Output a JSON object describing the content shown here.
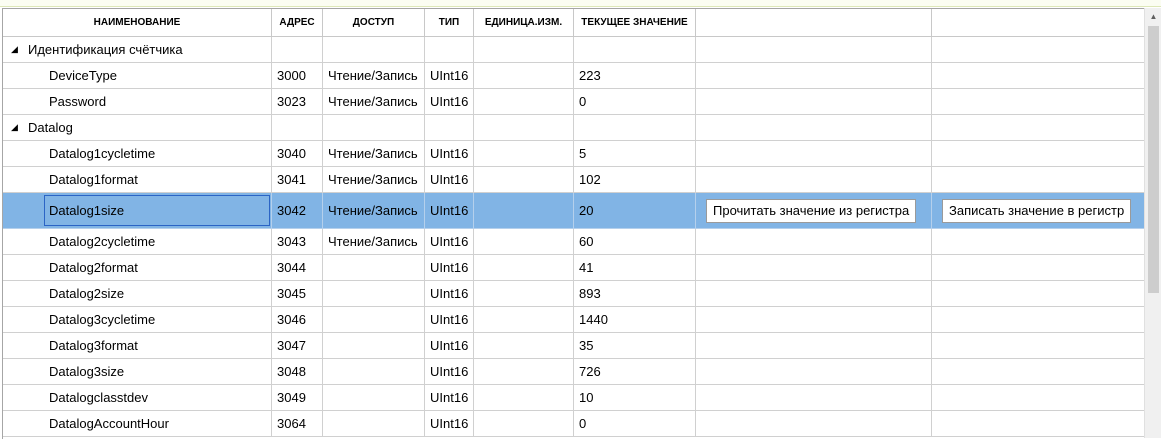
{
  "columns": [
    "НАИМЕНОВАНИЕ",
    "АДРЕС",
    "ДОСТУП",
    "ТИП",
    "ЕДИНИЦА.ИЗМ.",
    "ТЕКУЩЕЕ ЗНАЧЕНИЕ",
    "",
    ""
  ],
  "groups": [
    {
      "label": "Идентификация счётчика",
      "expand_glyph": "◢"
    },
    {
      "label": "Datalog",
      "expand_glyph": "◢"
    }
  ],
  "rows_group1": [
    {
      "name": "DeviceType",
      "address": "3000",
      "access": "Чтение/Запись",
      "type": "UInt16",
      "unit": "",
      "value": "223"
    },
    {
      "name": "Password",
      "address": "3023",
      "access": "Чтение/Запись",
      "type": "UInt16",
      "unit": "",
      "value": "0"
    }
  ],
  "rows_group2": [
    {
      "name": "Datalog1cycletime",
      "address": "3040",
      "access": "Чтение/Запись",
      "type": "UInt16",
      "unit": "",
      "value": "5"
    },
    {
      "name": "Datalog1format",
      "address": "3041",
      "access": "Чтение/Запись",
      "type": "UInt16",
      "unit": "",
      "value": "102"
    },
    {
      "name": "Datalog1size",
      "address": "3042",
      "access": "Чтение/Запись",
      "type": "UInt16",
      "unit": "",
      "value": "20"
    },
    {
      "name": "Datalog2cycletime",
      "address": "3043",
      "access": "Чтение/Запись",
      "type": "UInt16",
      "unit": "",
      "value": "60"
    },
    {
      "name": "Datalog2format",
      "address": "3044",
      "access": "",
      "type": "UInt16",
      "unit": "",
      "value": "41"
    },
    {
      "name": "Datalog2size",
      "address": "3045",
      "access": "",
      "type": "UInt16",
      "unit": "",
      "value": "893"
    },
    {
      "name": "Datalog3cycletime",
      "address": "3046",
      "access": "",
      "type": "UInt16",
      "unit": "",
      "value": "1440"
    },
    {
      "name": "Datalog3format",
      "address": "3047",
      "access": "",
      "type": "UInt16",
      "unit": "",
      "value": "35"
    },
    {
      "name": "Datalog3size",
      "address": "3048",
      "access": "",
      "type": "UInt16",
      "unit": "",
      "value": "726"
    },
    {
      "name": "Datalogclasstdev",
      "address": "3049",
      "access": "",
      "type": "UInt16",
      "unit": "",
      "value": "10"
    },
    {
      "name": "DatalogAccountHour",
      "address": "3064",
      "access": "",
      "type": "UInt16",
      "unit": "",
      "value": "0"
    }
  ],
  "selected_row_index_in_group2": 2,
  "buttons": {
    "read": "Прочитать значение из регистра",
    "write": "Записать значение в регистр"
  },
  "colors": {
    "selection": "#81b4e5",
    "focus_border": "#2b64c5",
    "grid_line": "#d0d0d0"
  }
}
